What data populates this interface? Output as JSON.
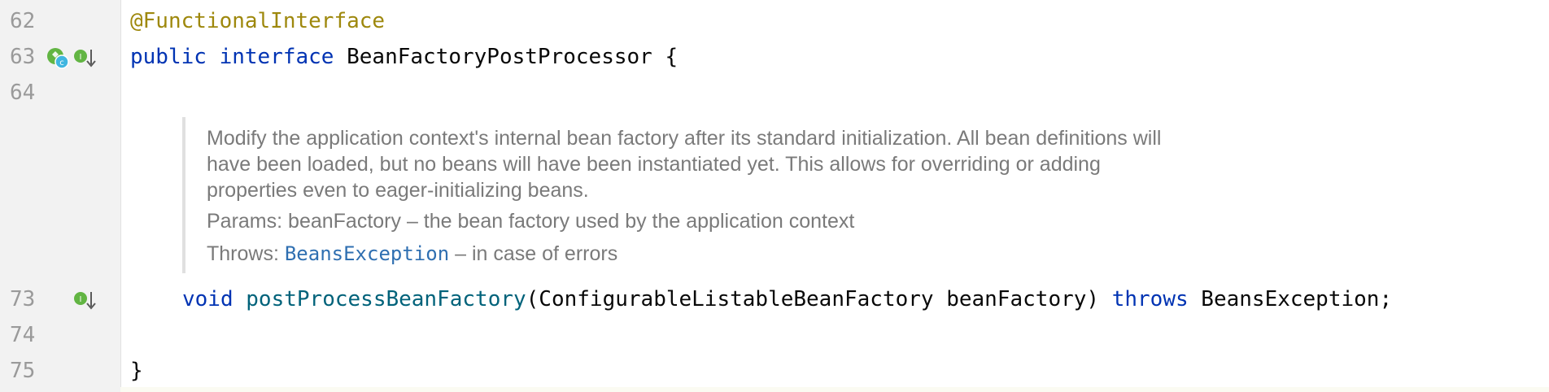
{
  "gutter": {
    "line_numbers": [
      "62",
      "63",
      "64",
      "73",
      "74",
      "75"
    ]
  },
  "code": {
    "annotation": "@FunctionalInterface",
    "kw_public": "public",
    "kw_interface": "interface",
    "interface_name": "BeanFactoryPostProcessor",
    "open_brace": "{",
    "kw_void": "void",
    "method_name": "postProcessBeanFactory",
    "params": "(ConfigurableListableBeanFactory beanFactory)",
    "kw_throws": "throws",
    "exception_tail": "BeansException;",
    "close_brace": "}"
  },
  "doc": {
    "description": "Modify the application context's internal bean factory after its standard initialization. All bean definitions will have been loaded, but no beans will have been instantiated yet. This allows for overriding or adding properties even to eager-initializing beans.",
    "params_label": "Params:",
    "params_text": "beanFactory – the bean factory used by the application context",
    "throws_label": "Throws:",
    "throws_link": "BeansException",
    "throws_text": "– in case of errors"
  },
  "colors": {
    "keyword": "#0033b3",
    "annotation": "#9e880d",
    "method": "#00627a",
    "doc_text": "#7a7a7a",
    "doc_link": "#2f6fb1"
  }
}
